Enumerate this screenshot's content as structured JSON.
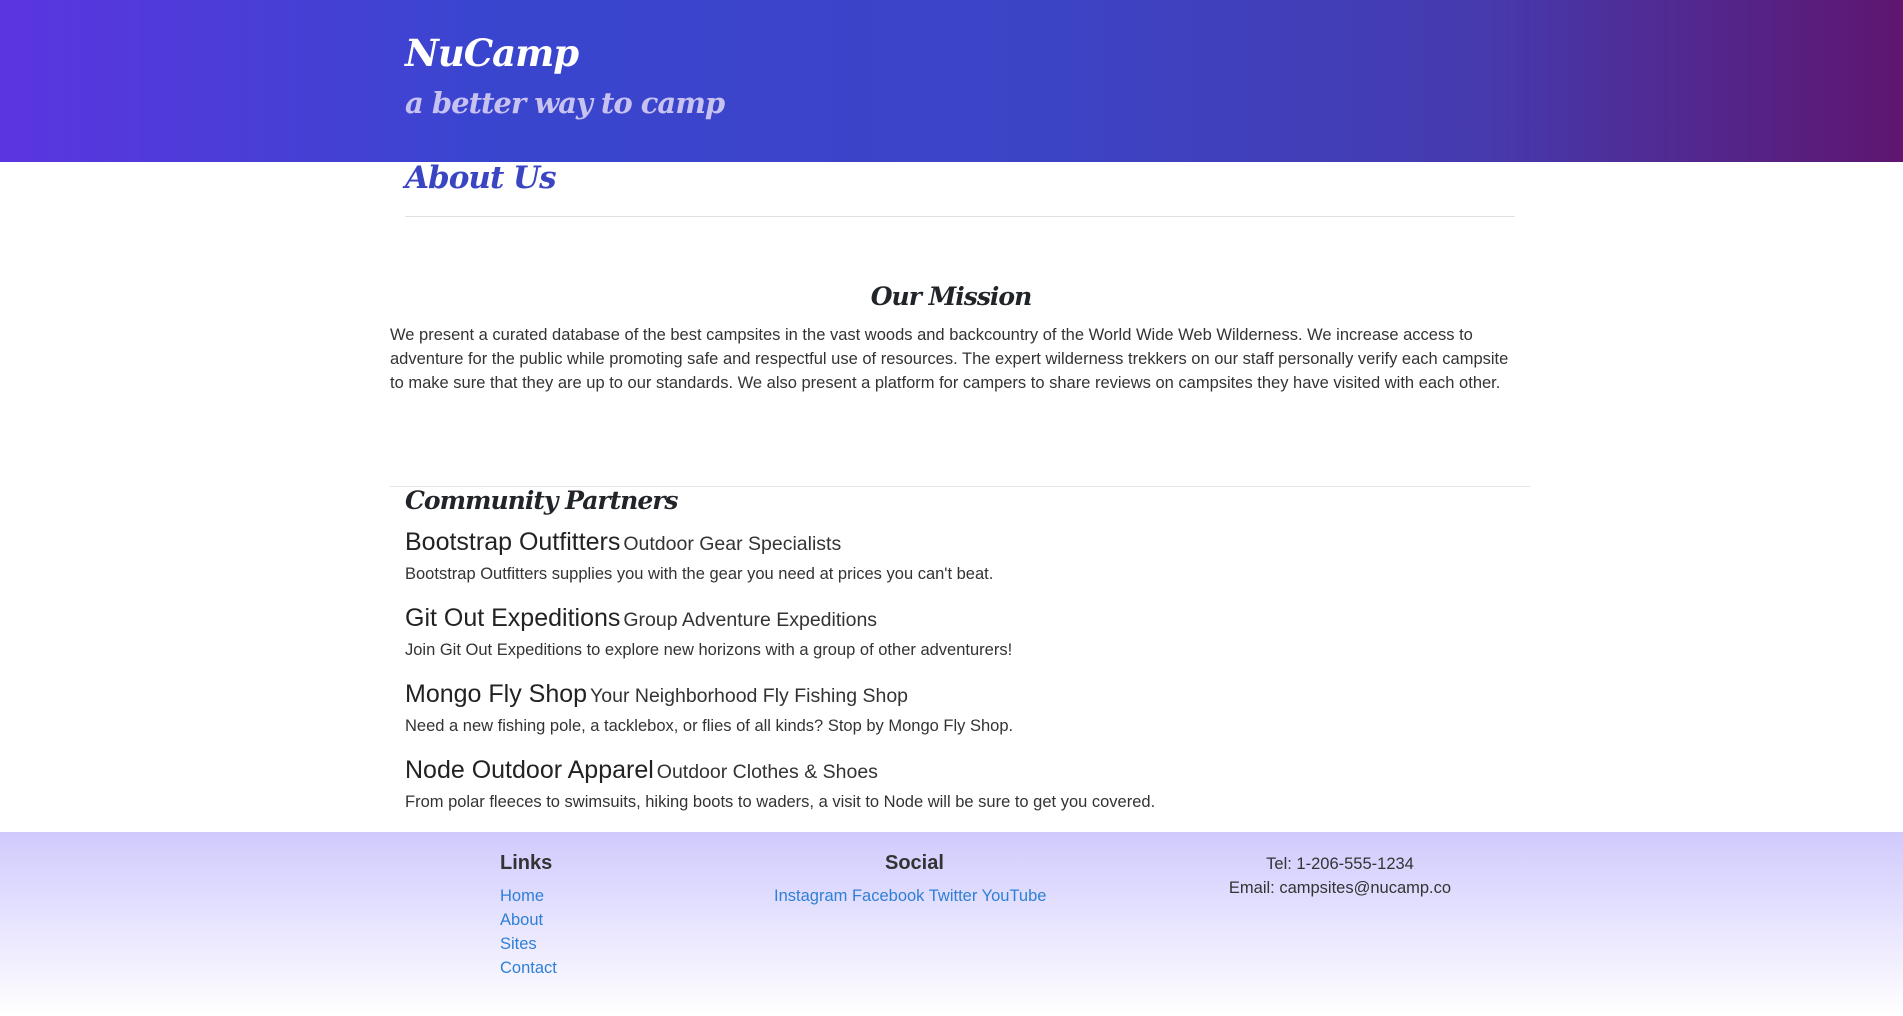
{
  "header": {
    "brand": "NuCamp",
    "tagline": "a better way to camp"
  },
  "page": {
    "title": "About Us"
  },
  "mission": {
    "heading": "Our Mission",
    "text": "We present a curated database of the best campsites in the vast woods and backcountry of the World Wide Web Wilderness. We increase access to adventure for the public while promoting safe and respectful use of resources. The expert wilderness trekkers on our staff personally verify each campsite to make sure that they are up to our standards. We also present a platform for campers to share reviews on campsites they have visited with each other."
  },
  "partners": {
    "heading": "Community Partners",
    "items": [
      {
        "name": "Bootstrap Outfitters",
        "specialty": "Outdoor Gear Specialists",
        "description": "Bootstrap Outfitters supplies you with the gear you need at prices you can't beat."
      },
      {
        "name": "Git Out Expeditions",
        "specialty": "Group Adventure Expeditions",
        "description": "Join Git Out Expeditions to explore new horizons with a group of other adventurers!"
      },
      {
        "name": "Mongo Fly Shop",
        "specialty": "Your Neighborhood Fly Fishing Shop",
        "description": "Need a new fishing pole, a tacklebox, or flies of all kinds? Stop by Mongo Fly Shop."
      },
      {
        "name": "Node Outdoor Apparel",
        "specialty": "Outdoor Clothes & Shoes",
        "description": "From polar fleeces to swimsuits, hiking boots to waders, a visit to Node will be sure to get you covered."
      }
    ]
  },
  "footer": {
    "links_title": "Links",
    "links": [
      "Home",
      "About",
      "Sites",
      "Contact"
    ],
    "social_title": "Social",
    "social": [
      "Instagram",
      "Facebook",
      "Twitter",
      "YouTube"
    ],
    "tel": "Tel: 1-206-555-1234",
    "email": "Email: campsites@nucamp.co"
  },
  "colors": {
    "header_gradient_start": "#5b35e0",
    "header_gradient_end": "#5e166f",
    "title_color": "#3a45c3",
    "link_color": "#2f7fd6",
    "footer_gradient_top": "#d0cafd"
  }
}
